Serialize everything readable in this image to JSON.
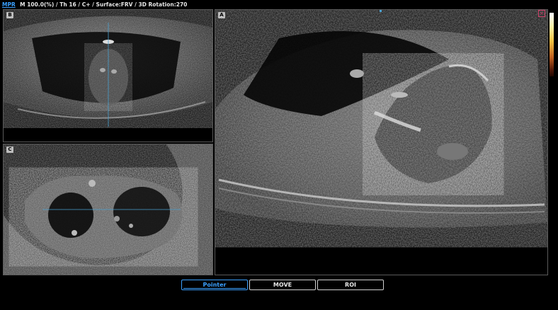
{
  "status_bar": {
    "mode": "MPR",
    "info": "M 100.0(%) / Th 16 / C+ / Surface:FRV / 3D Rotation:270"
  },
  "panels": {
    "a": {
      "label": "A"
    },
    "b": {
      "label": "B"
    },
    "c": {
      "label": "C"
    }
  },
  "toolbar": {
    "buttons": [
      {
        "label": "Pointer",
        "active": true
      },
      {
        "label": "MOVE",
        "active": false
      },
      {
        "label": "ROI",
        "active": false
      }
    ]
  },
  "colors": {
    "accent": "#3aa0ff",
    "close": "#d0406a"
  },
  "icons": {
    "close": "close-icon",
    "colorbar": "colorbar"
  }
}
